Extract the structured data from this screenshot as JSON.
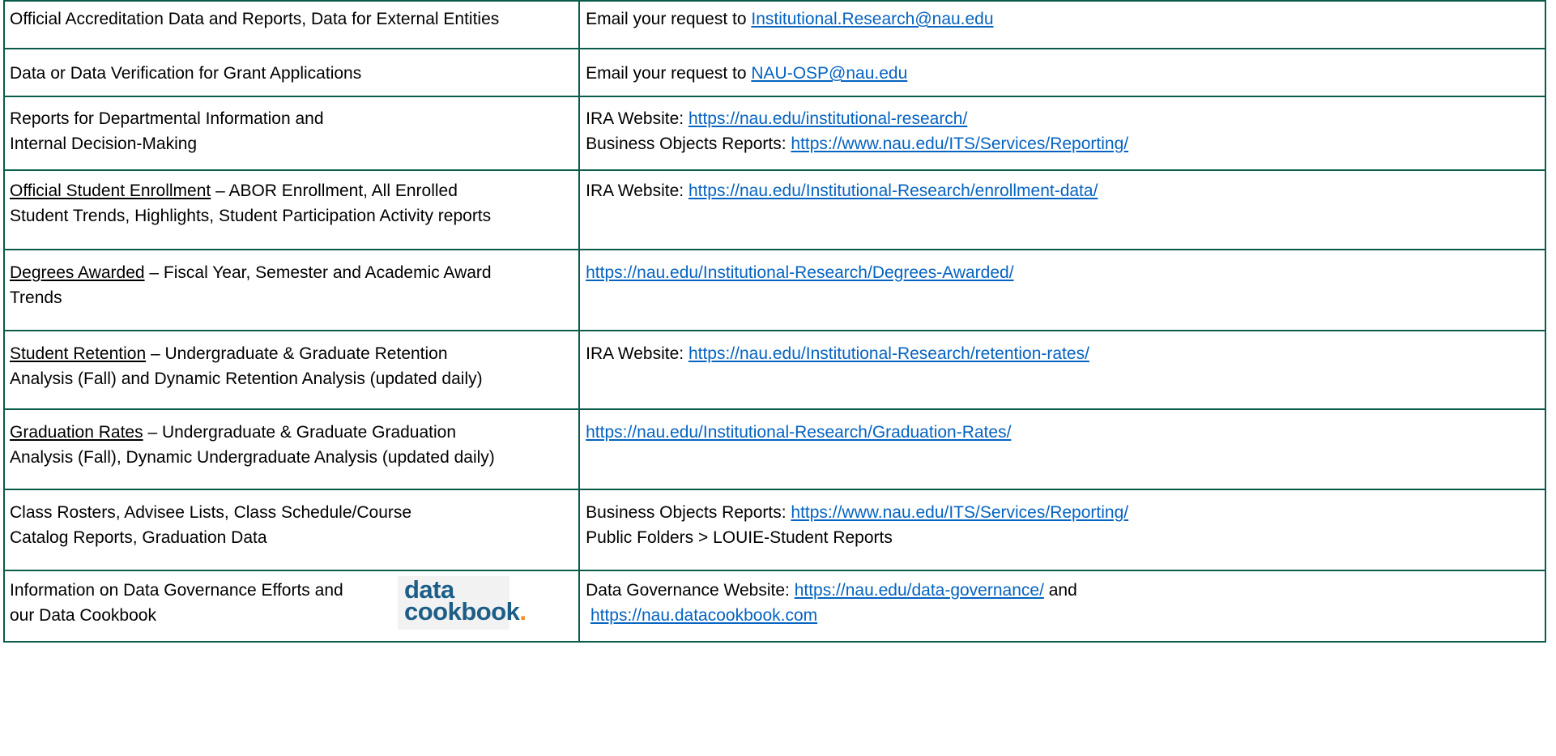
{
  "rows": [
    {
      "left": {
        "line1": "Official Accreditation Data and Reports, Data for External Entities"
      },
      "right": {
        "prefix": "Email your request to ",
        "link": "Institutional.Research@nau.edu"
      }
    },
    {
      "left": {
        "line1": "Data or Data Verification for Grant Applications"
      },
      "right": {
        "prefix": "Email your request to ",
        "link": "NAU-OSP@nau.edu"
      }
    },
    {
      "left": {
        "line1": "Reports for Departmental Information and",
        "line2": "Internal Decision-Making"
      },
      "right": {
        "line1_prefix": "IRA Website:  ",
        "line1_link": "https://nau.edu/institutional-research/",
        "line2_prefix": "Business Objects Reports: ",
        "line2_link": "https://www.nau.edu/ITS/Services/Reporting/"
      }
    },
    {
      "left": {
        "heading": "Official Student Enrollment",
        "line1_rest": " – ABOR Enrollment, All Enrolled",
        "line2": "Student Trends, Highlights, Student Participation Activity reports"
      },
      "right": {
        "prefix": "IRA Website: ",
        "link": "https://nau.edu/Institutional-Research/enrollment-data/"
      }
    },
    {
      "left": {
        "heading": "Degrees Awarded",
        "line1_rest": " – Fiscal Year, Semester and Academic Award",
        "line2": "Trends"
      },
      "right": {
        "link": "https://nau.edu/Institutional-Research/Degrees-Awarded/"
      }
    },
    {
      "left": {
        "heading": "Student Retention",
        "line1_rest": " – Undergraduate & Graduate Retention",
        "line2": "Analysis (Fall) and Dynamic Retention Analysis (updated daily)"
      },
      "right": {
        "prefix": "IRA Website: ",
        "link": "https://nau.edu/Institutional-Research/retention-rates/"
      }
    },
    {
      "left": {
        "heading": "Graduation Rates",
        "line1_rest": " – Undergraduate & Graduate Graduation",
        "line2": "Analysis (Fall), Dynamic Undergraduate Analysis (updated daily)"
      },
      "right": {
        "link": "https://nau.edu/Institutional-Research/Graduation-Rates/"
      }
    },
    {
      "left": {
        "line1": "Class Rosters, Advisee Lists, Class Schedule/Course",
        "line2": "Catalog Reports, Graduation Data"
      },
      "right": {
        "line1_prefix": "Business Objects Reports:  ",
        "line1_link": "https://www.nau.edu/ITS/Services/Reporting/",
        "line2": "Public Folders > LOUIE-Student Reports"
      }
    },
    {
      "left": {
        "line1": "Information on Data Governance Efforts and",
        "line2": "our Data Cookbook"
      },
      "right": {
        "line1_prefix": "Data Governance Website: ",
        "line1_link": "https://nau.edu/data-governance/",
        "line1_suffix": " and",
        "line2_link": "https://nau.datacookbook.com"
      }
    }
  ],
  "logo": {
    "word1": "data",
    "word2": "cookbook",
    "dot": ".",
    "name": "data-cookbook-logo"
  },
  "colors": {
    "border": "#0b5b4a",
    "link": "#0563c1",
    "logo_blue": "#1d5e88",
    "logo_orange": "#f28c1e"
  }
}
